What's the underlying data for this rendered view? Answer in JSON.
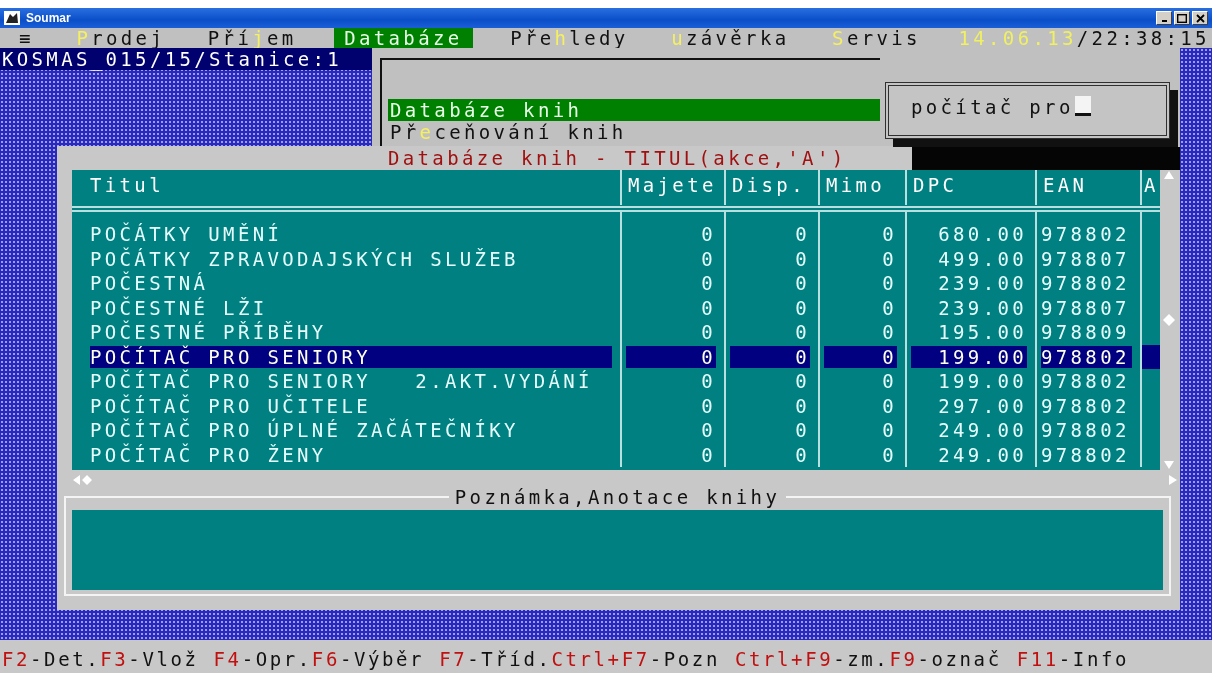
{
  "window": {
    "title": "Soumar"
  },
  "menu": {
    "items": [
      {
        "text": "≡",
        "selected": false
      },
      {
        "key": "P",
        "rest": "rodej",
        "selected": false
      },
      {
        "text": "Pří",
        "key": "j",
        "rest": "em",
        "selected": false
      },
      {
        "text": "Databáze",
        "selected": true
      },
      {
        "text": "Pře",
        "key": "h",
        "rest": "ledy",
        "selected": false
      },
      {
        "key": "u",
        "rest": "závěrka",
        "selected": false
      },
      {
        "key": "S",
        "rest": "ervis",
        "selected": false
      }
    ],
    "date": "14.06.13",
    "time": "/22:38:15"
  },
  "station": "KOSMAS_015/15/Stanice:1",
  "submenu": {
    "items": [
      {
        "text": "Databáze knih",
        "selected": true
      },
      {
        "text": "Př",
        "key": "e",
        "rest": "ceňování knih",
        "selected": false
      }
    ]
  },
  "search": {
    "value": "počítač pro"
  },
  "dialog": {
    "title": "Databáze knih - TITUL(akce,'A')",
    "table": {
      "columns": [
        "Titul",
        "Majete",
        "Disp.",
        "Mimo",
        "DPC",
        "EAN",
        "A"
      ],
      "rows": [
        {
          "cells": [
            "POČÁTKY UMĚNÍ",
            "0",
            "0",
            "0",
            "680.00",
            "978802"
          ],
          "selected": false
        },
        {
          "cells": [
            "POČÁTKY ZPRAVODAJSKÝCH SLUŽEB",
            "0",
            "0",
            "0",
            "499.00",
            "978807"
          ],
          "selected": false
        },
        {
          "cells": [
            "POČESTNÁ",
            "0",
            "0",
            "0",
            "239.00",
            "978802"
          ],
          "selected": false
        },
        {
          "cells": [
            "POČESTNÉ LŽI",
            "0",
            "0",
            "0",
            "239.00",
            "978807"
          ],
          "selected": false
        },
        {
          "cells": [
            "POČESTNÉ PŘÍBĚHY",
            "0",
            "0",
            "0",
            "195.00",
            "978809"
          ],
          "selected": false
        },
        {
          "cells": [
            "POČÍTAČ PRO SENIORY",
            "0",
            "0",
            "0",
            "199.00",
            "978802"
          ],
          "selected": true
        },
        {
          "cells": [
            "POČÍTAČ PRO SENIORY   2.AKT.VYDÁNÍ",
            "0",
            "0",
            "0",
            "199.00",
            "978802"
          ],
          "selected": false
        },
        {
          "cells": [
            "POČÍTAČ PRO UČITELE",
            "0",
            "0",
            "0",
            "297.00",
            "978802"
          ],
          "selected": false
        },
        {
          "cells": [
            "POČÍTAČ PRO ÚPLNÉ ZAČÁTEČNÍKY",
            "0",
            "0",
            "0",
            "249.00",
            "978802"
          ],
          "selected": false
        },
        {
          "cells": [
            "POČÍTAČ PRO ŽENY",
            "0",
            "0",
            "0",
            "249.00",
            "978802"
          ],
          "selected": false
        }
      ]
    },
    "notes": {
      "title": "Poznámka,Anotace knihy"
    }
  },
  "status_bar": {
    "groups": [
      [
        {
          "key": "F2",
          "label": "-Det."
        },
        {
          "key": "F3",
          "label": "-Vlož"
        }
      ],
      [
        {
          "key": "F4",
          "label": "-Opr."
        },
        {
          "key": "F6",
          "label": "-Výběr"
        }
      ],
      [
        {
          "key": "F7",
          "label": "-Tříd."
        },
        {
          "key": "Ctrl+F7",
          "label": "-Pozn"
        }
      ],
      [
        {
          "key": "Ctrl+F9",
          "label": "-zm."
        },
        {
          "key": "F9",
          "label": "-označ"
        }
      ],
      [
        {
          "key": "F11",
          "label": "-Info"
        }
      ]
    ]
  }
}
